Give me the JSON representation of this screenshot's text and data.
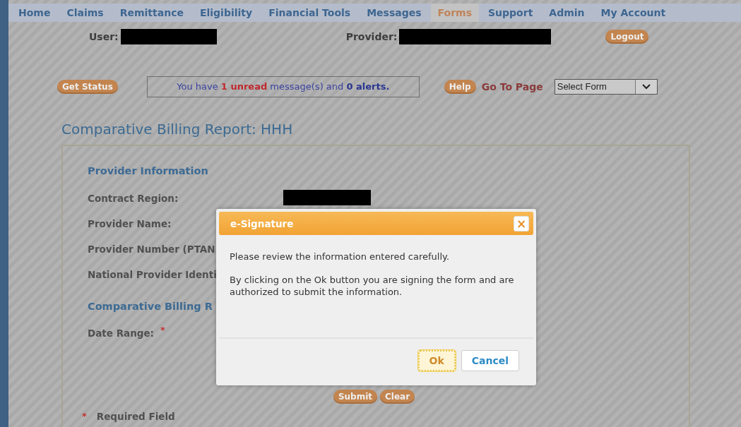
{
  "nav": [
    {
      "label": "Home",
      "selected": false
    },
    {
      "label": "Claims",
      "selected": false
    },
    {
      "label": "Remittance",
      "selected": false
    },
    {
      "label": "Eligibility",
      "selected": false
    },
    {
      "label": "Financial Tools",
      "selected": false
    },
    {
      "label": "Messages",
      "selected": false
    },
    {
      "label": "Forms",
      "selected": true
    },
    {
      "label": "Support",
      "selected": false
    },
    {
      "label": "Admin",
      "selected": false
    },
    {
      "label": "My Account",
      "selected": false
    }
  ],
  "header": {
    "user_label": "User:",
    "provider_label": "Provider:",
    "logout": "Logout"
  },
  "toolbar": {
    "get_status": "Get Status",
    "message": [
      {
        "kind": "plain",
        "text": "You have "
      },
      {
        "kind": "unread",
        "text": "1 unread"
      },
      {
        "kind": "plain",
        "text": " message(s) and "
      },
      {
        "kind": "alerts",
        "text": "0 alerts."
      }
    ],
    "help": "Help",
    "go_to_page": "Go To Page",
    "select": {
      "value": "Select Form"
    }
  },
  "title": "Comparative Billing Report: HHH",
  "form": {
    "sections": [
      {
        "heading": "Provider Information",
        "fields": [
          {
            "label": "Contract Region:",
            "kind": "redacted"
          },
          {
            "label": "Provider Name:",
            "kind": "plain"
          },
          {
            "label": "Provider Number (PTAN",
            "kind": "plain"
          },
          {
            "label": "National Provider Identi",
            "kind": "plain"
          }
        ]
      },
      {
        "heading": "Comparative Billing R",
        "fields": [
          {
            "label": "Date Range:",
            "kind": "required",
            "mark": "*"
          }
        ]
      }
    ],
    "buttons": [
      "Submit",
      "Clear"
    ],
    "required_note": {
      "mark": "*",
      "text": "Required Field"
    }
  },
  "dialog": {
    "title": "e-Signature",
    "close": "×",
    "paragraphs": [
      "Please review the information entered carefully.",
      "By clicking on the Ok button you are signing the form and are authorized to submit the information."
    ],
    "buttons": [
      {
        "label": "Ok",
        "kind": "primary",
        "focused": true
      },
      {
        "label": "Cancel",
        "kind": "secondary",
        "focused": false
      }
    ]
  }
}
